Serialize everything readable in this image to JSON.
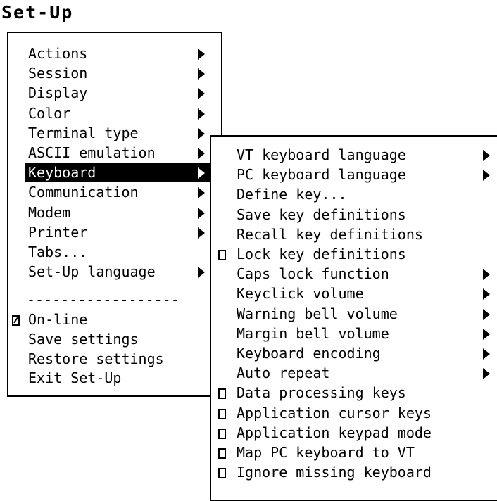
{
  "title": "Set-Up",
  "main_menu": {
    "items": [
      {
        "label": "Actions",
        "submenu": true
      },
      {
        "label": "Session",
        "submenu": true
      },
      {
        "label": "Display",
        "submenu": true
      },
      {
        "label": "Color",
        "submenu": true
      },
      {
        "label": "Terminal type",
        "submenu": true
      },
      {
        "label": "ASCII emulation",
        "submenu": true
      },
      {
        "label": "Keyboard",
        "submenu": true,
        "selected": true
      },
      {
        "label": "Communication",
        "submenu": true
      },
      {
        "label": "Modem",
        "submenu": true
      },
      {
        "label": "Printer",
        "submenu": true
      },
      {
        "label": "Tabs...",
        "submenu": false
      },
      {
        "label": "Set-Up language",
        "submenu": true
      }
    ],
    "separator": "------------------",
    "bottom_items": [
      {
        "label": "On-line",
        "checkbox": true,
        "checked": true
      },
      {
        "label": "Save settings",
        "checkbox": false
      },
      {
        "label": "Restore settings",
        "checkbox": false
      },
      {
        "label": "Exit Set-Up",
        "checkbox": false
      }
    ]
  },
  "keyboard_menu": {
    "items": [
      {
        "label": "VT keyboard language",
        "submenu": true,
        "checkbox": false
      },
      {
        "label": "PC keyboard language",
        "submenu": true,
        "checkbox": false
      },
      {
        "label": "Define key...",
        "submenu": false,
        "checkbox": false
      },
      {
        "label": "Save key definitions",
        "submenu": false,
        "checkbox": false
      },
      {
        "label": "Recall key definitions",
        "submenu": false,
        "checkbox": false
      },
      {
        "label": "Lock key definitions",
        "submenu": false,
        "checkbox": true,
        "checked": false
      },
      {
        "label": "Caps lock function",
        "submenu": true,
        "checkbox": false
      },
      {
        "label": "Keyclick volume",
        "submenu": true,
        "checkbox": false
      },
      {
        "label": "Warning bell volume",
        "submenu": true,
        "checkbox": false
      },
      {
        "label": "Margin bell volume",
        "submenu": true,
        "checkbox": false
      },
      {
        "label": "Keyboard encoding",
        "submenu": true,
        "checkbox": false
      },
      {
        "label": "Auto repeat",
        "submenu": true,
        "checkbox": false
      },
      {
        "label": "Data processing keys",
        "submenu": false,
        "checkbox": true,
        "checked": false
      },
      {
        "label": "Application cursor keys",
        "submenu": false,
        "checkbox": true,
        "checked": false
      },
      {
        "label": "Application keypad mode",
        "submenu": false,
        "checkbox": true,
        "checked": false
      },
      {
        "label": "Map PC keyboard to VT",
        "submenu": false,
        "checkbox": true,
        "checked": false
      },
      {
        "label": "Ignore missing keyboard",
        "submenu": false,
        "checkbox": true,
        "checked": false
      }
    ]
  },
  "icons": {
    "submenu": "submenu-arrow-icon",
    "checkbox": "checkbox-icon"
  }
}
